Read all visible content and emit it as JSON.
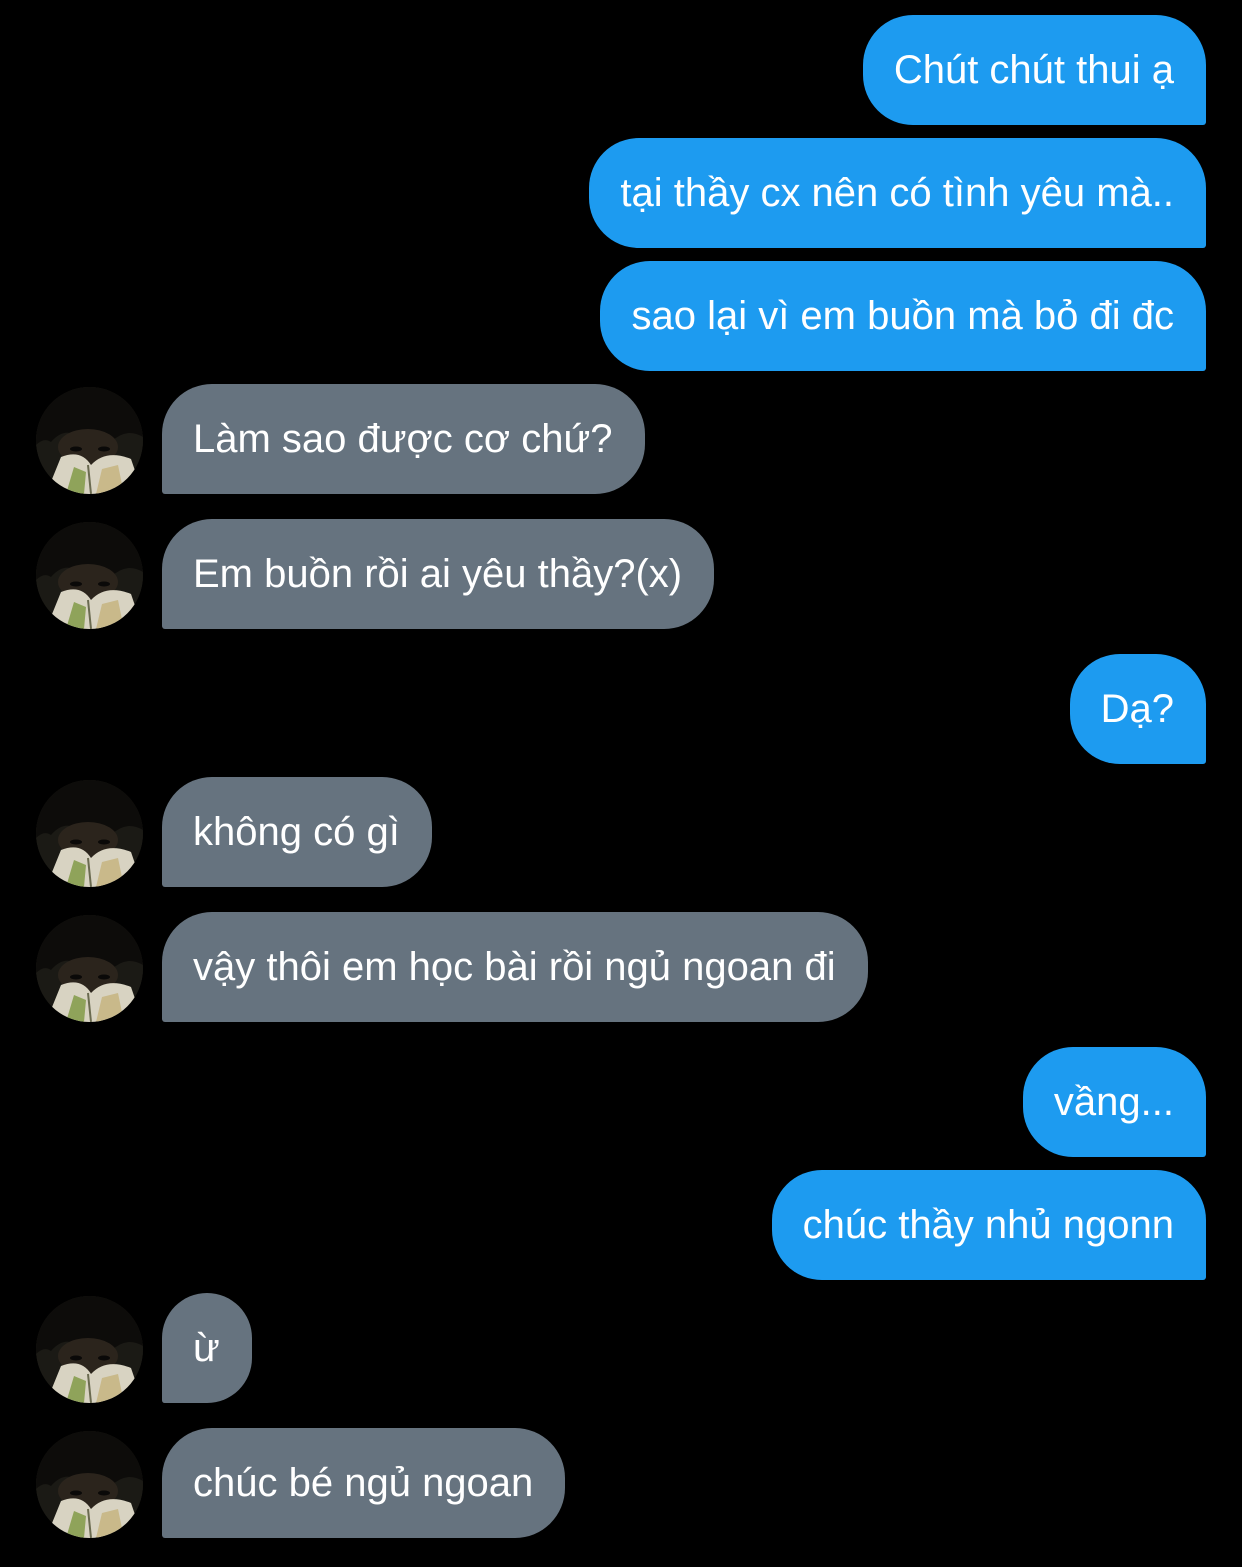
{
  "messages": [
    {
      "direction": "sent",
      "text": "Chút chút thui ạ"
    },
    {
      "direction": "sent",
      "text": "tại thầy cx nên có tình yêu mà.."
    },
    {
      "direction": "sent",
      "text": "sao lại vì em buồn mà bỏ đi đc"
    },
    {
      "direction": "received",
      "text": "Làm sao được cơ chứ?"
    },
    {
      "direction": "received",
      "text": "Em buồn rồi ai yêu thầy?(x)"
    },
    {
      "direction": "sent",
      "text": "Dạ?"
    },
    {
      "direction": "received",
      "text": "không có gì"
    },
    {
      "direction": "received",
      "text": "vậy thôi em học bài rồi ngủ ngoan đi"
    },
    {
      "direction": "sent",
      "text": "vầng..."
    },
    {
      "direction": "sent",
      "text": "chúc thầy nhủ ngonn"
    },
    {
      "direction": "received",
      "text": "ừ"
    },
    {
      "direction": "received",
      "text": "chúc bé ngủ ngoan"
    }
  ],
  "colors": {
    "background": "#000000",
    "sent_bubble": "#1d9bf0",
    "received_bubble": "#66737f",
    "text": "#ffffff"
  },
  "icons": {
    "avatar": "contact-profile-photo"
  }
}
